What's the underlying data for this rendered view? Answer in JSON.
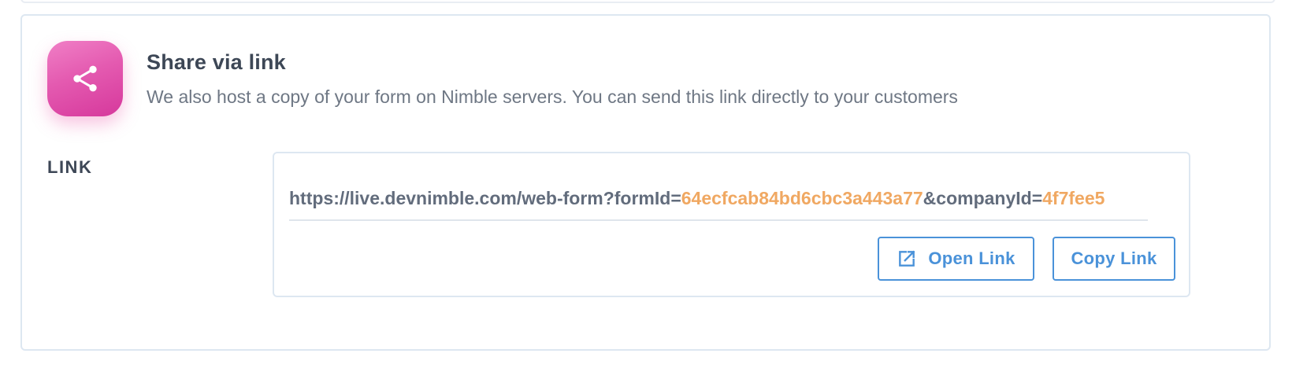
{
  "share": {
    "title": "Share via link",
    "description": "We also host a copy of your form on Nimble servers. You can send this link directly to your customers",
    "icon": "share-icon"
  },
  "link": {
    "label": "LINK",
    "url_segments": [
      {
        "text": "https://live.devnimble.com/web-form?formId=",
        "kind": "base"
      },
      {
        "text": "64ecfcab84bd6cbc3a443a77",
        "kind": "param"
      },
      {
        "text": "&companyId=",
        "kind": "base"
      },
      {
        "text": "4f7fee5",
        "kind": "param"
      }
    ],
    "open_button_label": "Open Link",
    "open_button_icon": "external-link-icon",
    "copy_button_label": "Copy Link"
  },
  "colors": {
    "accent": "#4a92d9",
    "url_param": "#f0a862",
    "icon_tile": "#e45ab0"
  }
}
